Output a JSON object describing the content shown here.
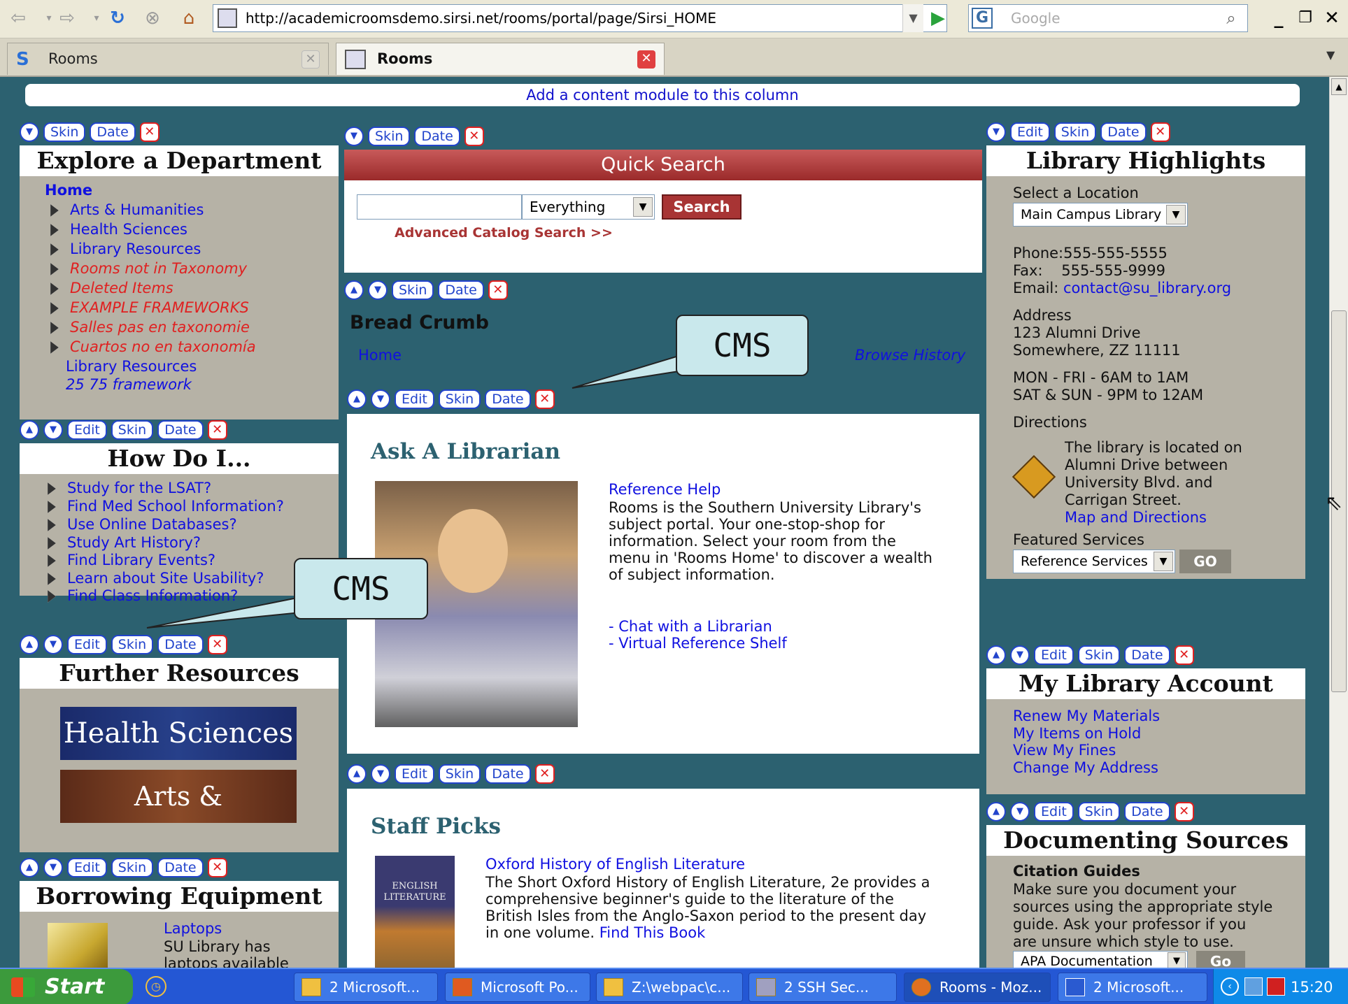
{
  "browser": {
    "url": "http://academicroomsdemo.sirsi.net/rooms/portal/page/Sirsi_HOME",
    "search_placeholder": "Google",
    "tabs": [
      {
        "label": "Rooms"
      },
      {
        "label": "Rooms"
      }
    ]
  },
  "page": {
    "add_module": "Add a content module to this column",
    "controls": {
      "edit": "Edit",
      "skin": "Skin",
      "date": "Date",
      "close": "✕",
      "up": "▲",
      "down": "▼"
    },
    "explore": {
      "title": "Explore a Department",
      "home": "Home",
      "items": [
        {
          "label": "Arts & Humanities"
        },
        {
          "label": "Health Sciences"
        },
        {
          "label": "Library Resources"
        },
        {
          "label": "Rooms not in Taxonomy"
        },
        {
          "label": "Deleted Items"
        },
        {
          "label": "EXAMPLE FRAMEWORKS"
        },
        {
          "label": "Salles pas en taxonomie"
        },
        {
          "label": "Cuartos no en taxonomía"
        }
      ],
      "sub1": "Library Resources",
      "sub2": "25 75 framework"
    },
    "howdo": {
      "title": "How Do I...",
      "items": [
        {
          "label": "Study for the LSAT?"
        },
        {
          "label": "Find Med School Information?"
        },
        {
          "label": "Use Online Databases?"
        },
        {
          "label": "Study Art History?"
        },
        {
          "label": "Find Library Events?"
        },
        {
          "label": "Learn about Site Usability?"
        },
        {
          "label": "Find Class Information?"
        }
      ]
    },
    "further": {
      "title": "Further Resources",
      "banner1": "Health Sciences",
      "banner2": "Arts & Humanities"
    },
    "borrow": {
      "title": "Borrowing Equipment",
      "link": "Laptops",
      "text1": "SU Library has",
      "text2": "laptops available"
    },
    "quicksearch": {
      "title": "Quick Search",
      "input_value": "",
      "scope": "Everything",
      "button": "Search",
      "advanced": "Advanced Catalog Search >>"
    },
    "breadcrumb": {
      "title": "Bread Crumb",
      "home": "Home",
      "history": "Browse History"
    },
    "ask": {
      "title": "Ask A Librarian",
      "link": "Reference Help",
      "lines": [
        "Rooms is the Southern University Library's",
        "subject portal. Your one-stop-shop for",
        "information. Select your room from the",
        "menu in 'Rooms Home' to discover a wealth",
        "of subject information."
      ],
      "chat_prefix": "- ",
      "chat": "Chat with a Librarian",
      "shelf_prefix": "- ",
      "shelf": "Virtual Reference Shelf"
    },
    "staff": {
      "title": "Staff Picks",
      "book_title": "Oxford History of English Literature",
      "cover_text": "ENGLISH LITERATURE",
      "lines": [
        "The Short Oxford History of English Literature, 2e provides a",
        "comprehensive beginner's guide to the literature of the",
        "British Isles from the Anglo-Saxon period to the present day",
        "in one volume."
      ],
      "find": "Find This Book"
    },
    "highlights": {
      "title": "Library Highlights",
      "select_label": "Select a Location",
      "location": "Main Campus Library",
      "phone": "Phone:555-555-5555",
      "fax": "Fax:    555-555-9999",
      "email_label": "Email: ",
      "email": "contact@su_library.org",
      "address_label": "Address",
      "address1": "123 Alumni Drive",
      "address2": "Somewhere, ZZ 11111",
      "hours1": "MON - FRI - 6AM to 1AM",
      "hours2": "SAT & SUN - 9PM to 12AM",
      "directions_label": "Directions",
      "dir_lines": [
        "The library is located on",
        "Alumni Drive between",
        "University Blvd. and",
        "Carrigan Street."
      ],
      "map_link": "Map and Directions",
      "featured_label": "Featured Services",
      "featured": "Reference Services",
      "go": "GO"
    },
    "account": {
      "title": "My Library Account",
      "links": [
        {
          "label": "Renew My Materials"
        },
        {
          "label": "My Items on Hold"
        },
        {
          "label": "View My Fines"
        },
        {
          "label": "Change My Address"
        }
      ]
    },
    "documenting": {
      "title": "Documenting Sources",
      "subtitle": "Citation Guides",
      "lines": [
        "Make sure you document your",
        "sources using the appropriate style",
        "guide. Ask your professor if you",
        "are unsure which style to use."
      ],
      "select": "APA Documentation",
      "go": "Go"
    },
    "callouts": {
      "c1": "CMS",
      "c2": "CMS"
    }
  },
  "taskbar": {
    "start": "Start",
    "items": [
      {
        "label": "2 Microsoft..."
      },
      {
        "label": "Microsoft Po..."
      },
      {
        "label": "Z:\\webpac\\c..."
      },
      {
        "label": "2 SSH Sec..."
      },
      {
        "label": "Rooms - Moz..."
      },
      {
        "label": "2 Microsoft..."
      }
    ],
    "clock": "15:20"
  },
  "colors": {
    "page_bg": "#2c6170",
    "module_bg": "#b6b2a6",
    "link": "#1010e0",
    "red": "#e02020",
    "search_header": "#a83434"
  }
}
